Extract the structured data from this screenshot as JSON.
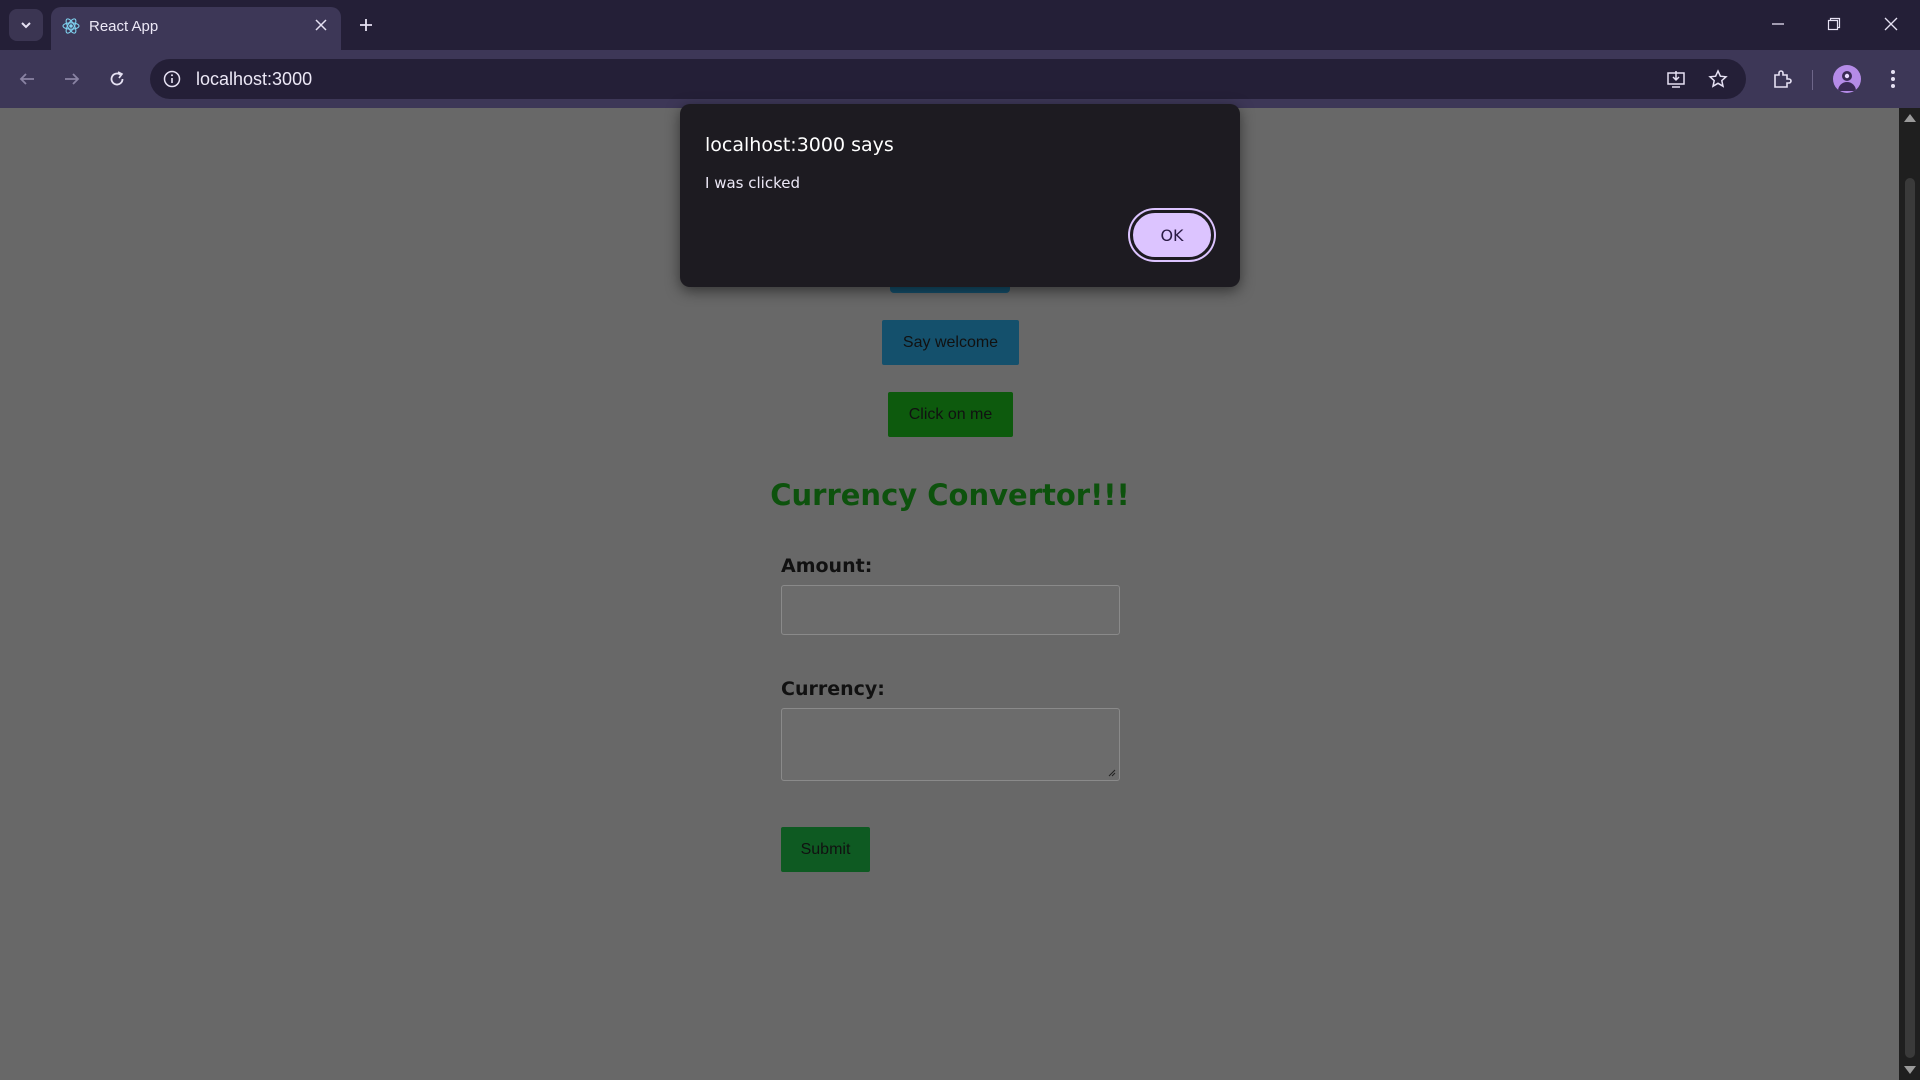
{
  "browser": {
    "tab_title": "React App",
    "url": "localhost:3000"
  },
  "page": {
    "buttons": {
      "welcome_label": "Say welcome",
      "click_label": "Click on me",
      "submit_label": "Submit"
    },
    "heading": "Currency Convertor!!!",
    "form": {
      "amount_label": "Amount:",
      "amount_value": "",
      "currency_label": "Currency:",
      "currency_value": ""
    }
  },
  "alert": {
    "title": "localhost:3000 says",
    "message": "I was clicked",
    "ok_label": "OK"
  },
  "colors": {
    "tab_bar": "#241f37",
    "toolbar": "#3d3757",
    "page_bg": "#686868",
    "heading": "#0d520d",
    "welcome_button": "#14506c",
    "click_button": "#0d5a0d",
    "submit_button": "#0e5a22",
    "dialog_bg": "#1d1b21",
    "ok_button": "#dcc4ff"
  }
}
